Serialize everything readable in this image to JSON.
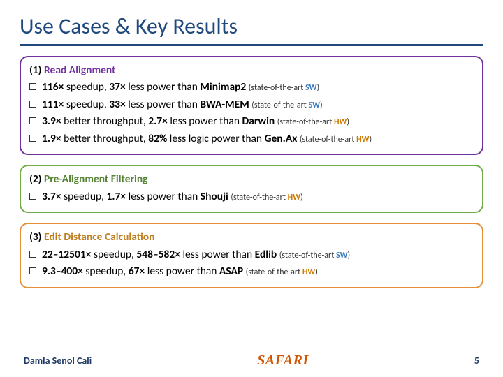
{
  "title": "Use Cases & Key Results",
  "cards": [
    {
      "num": "(1)",
      "name": "Read Alignment",
      "items": [
        {
          "a": "116×",
          "b": "speedup,",
          "c": "37×",
          "d": "less power than",
          "tool": "Minimap2",
          "note": "(state-of-the-art",
          "kind": "SW",
          "close": ")"
        },
        {
          "a": "111×",
          "b": "speedup,",
          "c": "33×",
          "d": "less power than",
          "tool": "BWA-MEM",
          "note": "(state-of-the-art",
          "kind": "SW",
          "close": ")"
        },
        {
          "a": "3.9×",
          "b": "better throughput,",
          "c": "2.7×",
          "d": "less power than",
          "tool": "Darwin",
          "note": "(state-of-the-art",
          "kind": "HW",
          "close": ")"
        },
        {
          "a": "1.9×",
          "b": "better throughput,",
          "c": "82%",
          "d": "less logic power than",
          "tool": "Gen.Ax",
          "note": "(state-of-the-art",
          "kind": "HW",
          "close": ")"
        }
      ]
    },
    {
      "num": "(2)",
      "name": "Pre-Alignment Filtering",
      "items": [
        {
          "a": "3.7×",
          "b": "speedup,",
          "c": "1.7×",
          "d": "less power than",
          "tool": "Shouji",
          "note": "(state-of-the-art",
          "kind": "HW",
          "close": ")"
        }
      ]
    },
    {
      "num": "(3)",
      "name": "Edit Distance Calculation",
      "items": [
        {
          "a": "22–12501×",
          "b": "speedup,",
          "c": "548–582×",
          "d": "less power than",
          "tool": "Edlib",
          "note": "(state-of-the-art",
          "kind": "SW",
          "close": ")"
        },
        {
          "a": "9.3–400×",
          "b": "speedup,",
          "c": "67×",
          "d": "less power than",
          "tool": "ASAP",
          "note": "(state-of-the-art",
          "kind": "HW",
          "close": ")"
        }
      ]
    }
  ],
  "footer": {
    "author": "Damla Senol Cali",
    "logo": "SAFARI",
    "page": "5"
  }
}
